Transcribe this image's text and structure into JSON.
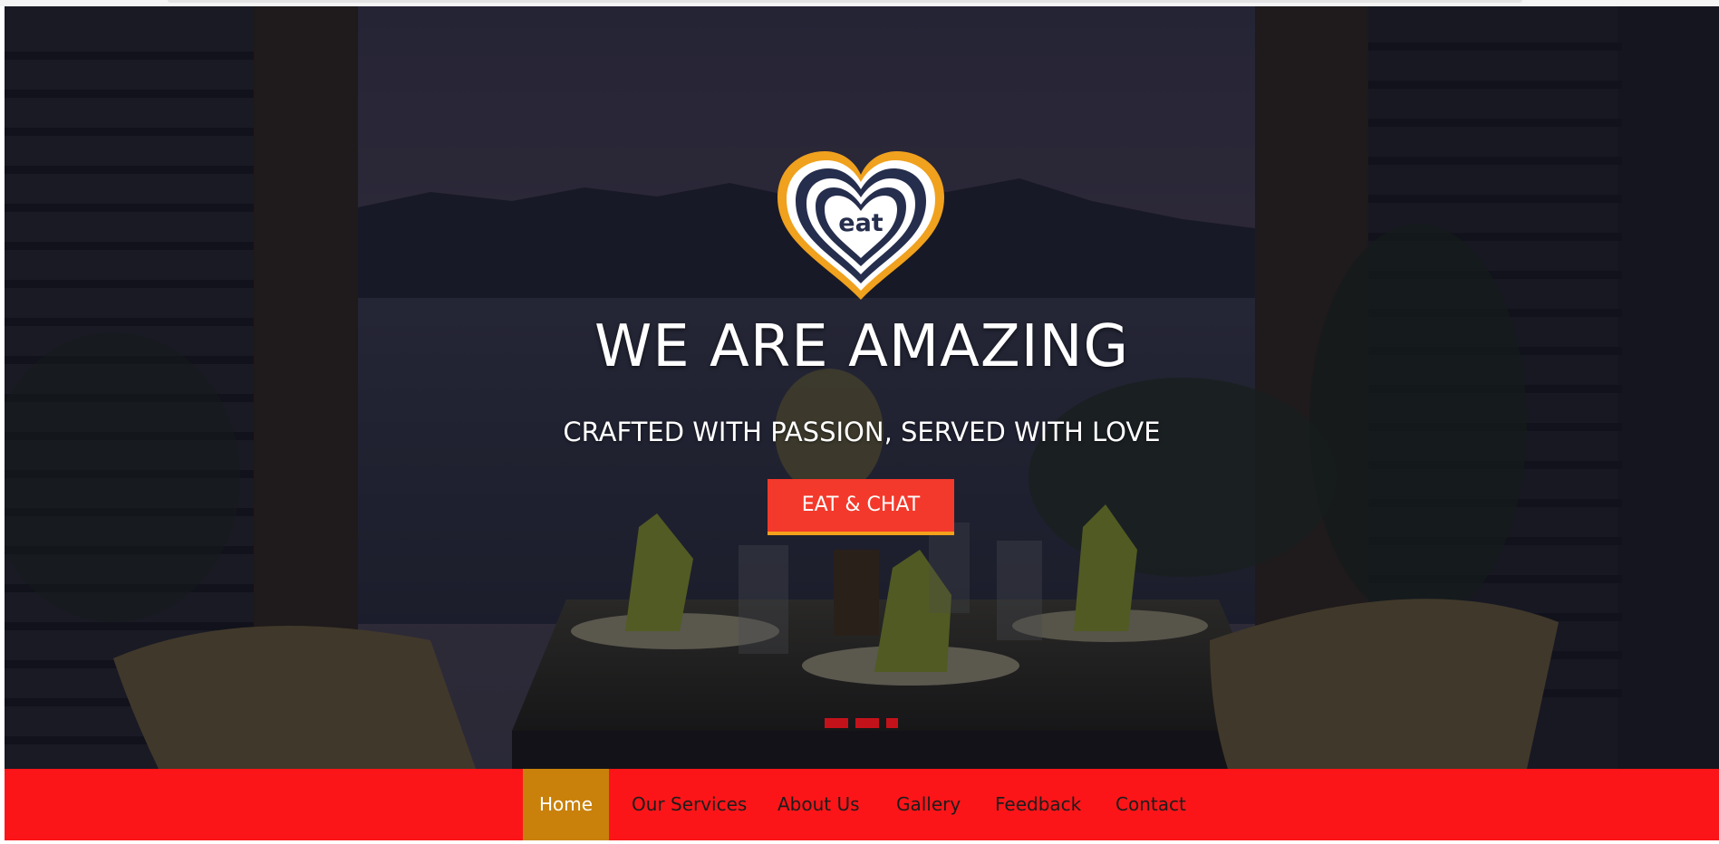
{
  "hero": {
    "logo_text": "eat",
    "headline": "WE ARE AMAZING",
    "tagline": "CRAFTED WITH PASSION, SERVED WITH LOVE",
    "cta_label": "EAT & CHAT",
    "slides": {
      "count": 3,
      "active_index": 2
    }
  },
  "nav": {
    "items": [
      {
        "label": "Home",
        "active": true
      },
      {
        "label": "Our Services",
        "active": false
      },
      {
        "label": "About Us",
        "active": false
      },
      {
        "label": "Gallery",
        "active": false
      },
      {
        "label": "Feedback",
        "active": false
      },
      {
        "label": "Contact",
        "active": false
      }
    ]
  },
  "colors": {
    "nav_background": "#fc1518",
    "nav_active": "#c9810b",
    "cta_background": "#f3392b",
    "cta_accent": "#f3a21c",
    "slide_dot": "#c4121a",
    "logo_orange": "#f0a11d",
    "logo_navy": "#262e4d"
  }
}
